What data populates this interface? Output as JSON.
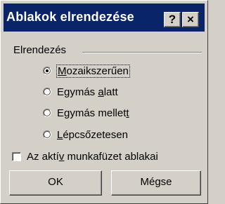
{
  "window": {
    "title": "Ablakok elrendezése",
    "help_glyph": "?",
    "close_glyph": "×"
  },
  "group": {
    "label": "Elrendezés",
    "options": [
      {
        "pre": "",
        "key": "M",
        "post": "ozaikszerűen",
        "checked": true
      },
      {
        "pre": "Egymás ",
        "key": "a",
        "post": "latt",
        "checked": false
      },
      {
        "pre": "Egymás mellet",
        "key": "t",
        "post": "",
        "checked": false
      },
      {
        "pre": "",
        "key": "L",
        "post": "épcsőzetesen",
        "checked": false
      }
    ]
  },
  "checkbox": {
    "pre": "Az aktí",
    "key": "v",
    "post": " munkafüzet ablakai",
    "checked": false
  },
  "buttons": {
    "ok": "OK",
    "cancel": "Mégse"
  }
}
